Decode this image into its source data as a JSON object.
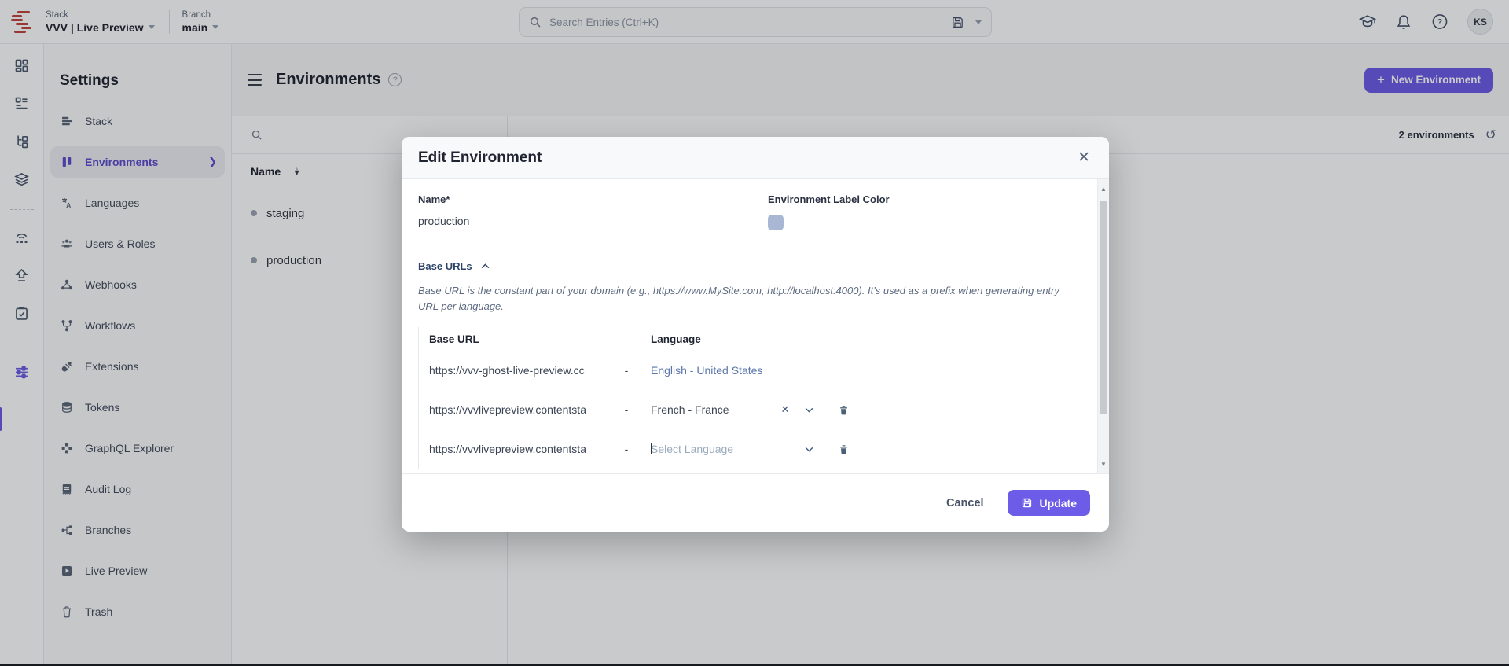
{
  "colors": {
    "accent": "#6c5ce7",
    "label_swatch": "#a9b7d4",
    "logo_red": "#c2443c"
  },
  "topbar": {
    "stack_label": "Stack",
    "stack_value": "VVV | Live Preview",
    "branch_label": "Branch",
    "branch_value": "main",
    "search_placeholder": "Search Entries (Ctrl+K)",
    "avatar_initials": "KS",
    "icons": [
      "contentstack-logo",
      "search-icon",
      "save-search-icon",
      "saved-searches-caret",
      "learning-icon",
      "notifications-icon",
      "help-icon"
    ]
  },
  "rail": {
    "items": [
      "dashboard",
      "entries",
      "content-models",
      "releases",
      "automate",
      "publish-queue",
      "tasks",
      "settings"
    ]
  },
  "sidebar": {
    "title": "Settings",
    "items": [
      {
        "label": "Stack"
      },
      {
        "label": "Environments"
      },
      {
        "label": "Languages"
      },
      {
        "label": "Users & Roles"
      },
      {
        "label": "Webhooks"
      },
      {
        "label": "Workflows"
      },
      {
        "label": "Extensions"
      },
      {
        "label": "Tokens"
      },
      {
        "label": "GraphQL Explorer"
      },
      {
        "label": "Audit Log"
      },
      {
        "label": "Branches"
      },
      {
        "label": "Live Preview"
      },
      {
        "label": "Trash"
      }
    ]
  },
  "content": {
    "title": "Environments",
    "new_button_label": "New Environment",
    "count_label": "2 environments",
    "table": {
      "name_header": "Name",
      "rows": [
        {
          "name": "staging"
        },
        {
          "name": "production"
        }
      ]
    }
  },
  "modal": {
    "title": "Edit Environment",
    "name_label": "Name*",
    "name_value": "production",
    "color_label": "Environment Label Color",
    "base_urls_title": "Base URLs",
    "description": "Base URL is the constant part of your domain (e.g., https://www.MySite.com, http://localhost:4000). It's used as a prefix when generating entry URL per language.",
    "table": {
      "base_url_header": "Base URL",
      "language_header": "Language",
      "rows": [
        {
          "base_url": "https://vvv-ghost-live-preview.cc",
          "dash": "-",
          "language": "English - United States"
        },
        {
          "base_url": "https://vvvlivepreview.contentsta",
          "dash": "-",
          "language": "French - France"
        },
        {
          "base_url": "https://vvvlivepreview.contentsta",
          "dash": "-",
          "language": "",
          "language_placeholder": "Select Language"
        }
      ]
    },
    "cancel_label": "Cancel",
    "update_label": "Update"
  }
}
